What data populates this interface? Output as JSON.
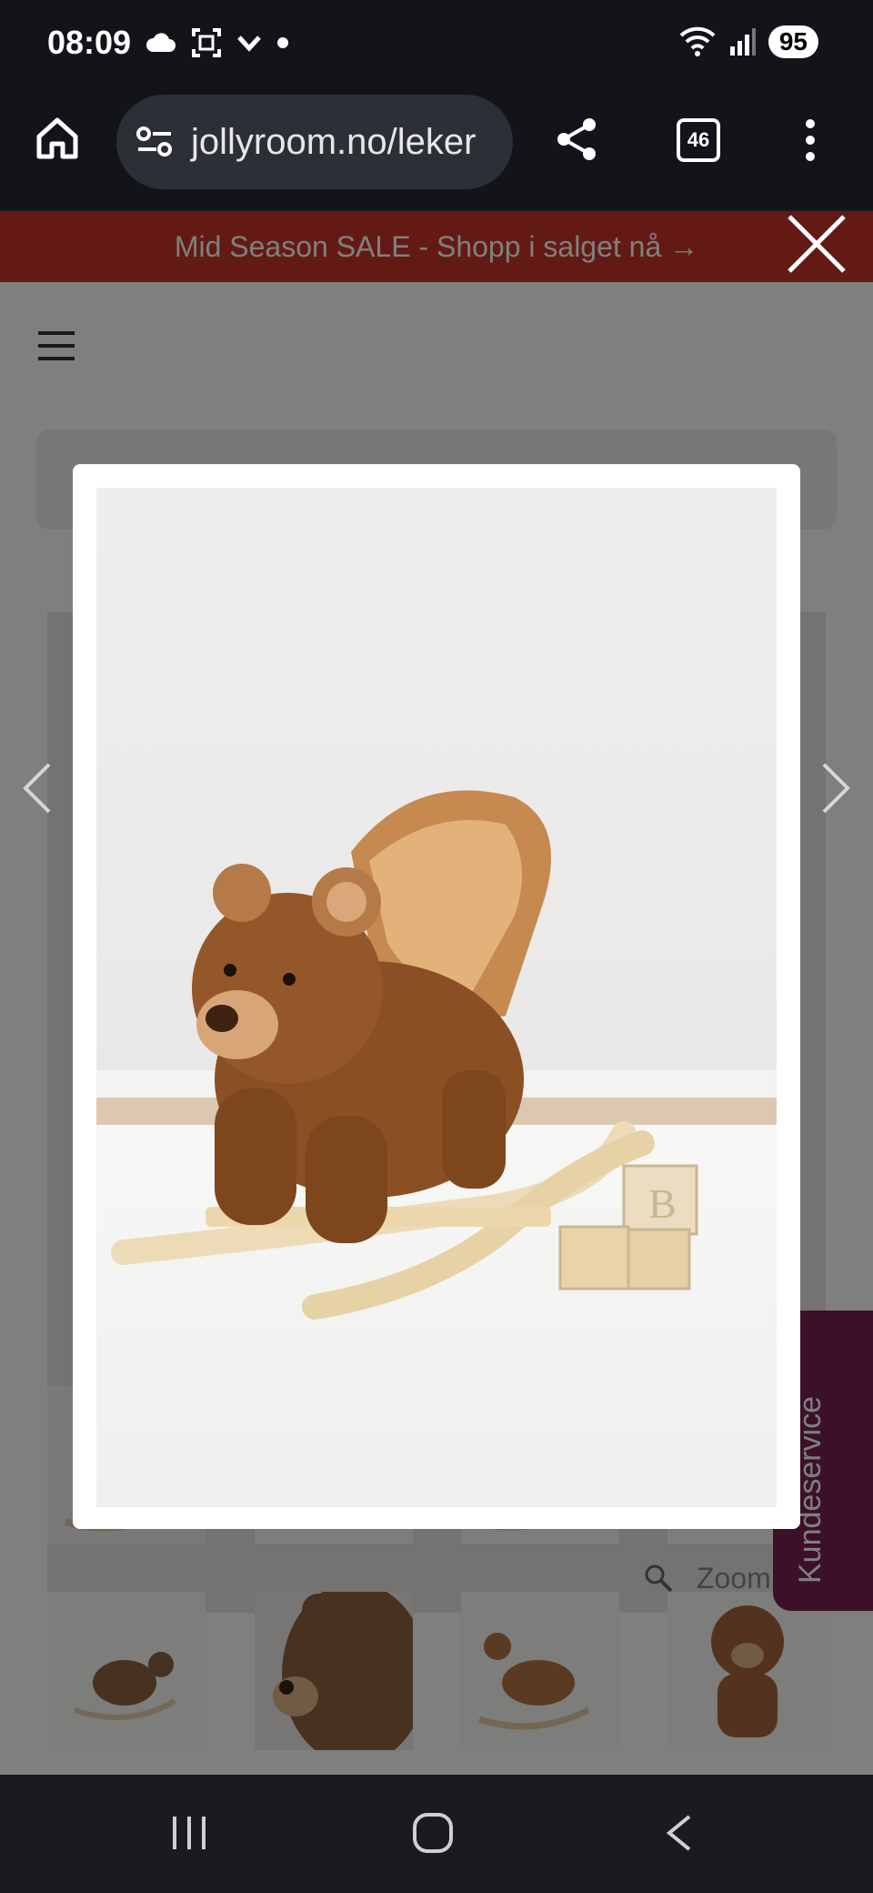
{
  "status": {
    "time": "08:09",
    "battery": "95"
  },
  "browser": {
    "url": "jollyroom.no/leker",
    "tabs": "46"
  },
  "page": {
    "promo": "Mid Season SALE - Shopp i salget nå →",
    "zoom_label": "Zoom",
    "side_tab": "Kundeservice"
  },
  "icons": [
    "home-icon",
    "site-settings-icon",
    "share-icon",
    "tabs-icon",
    "more-icon",
    "close-icon",
    "chevron-left-icon",
    "chevron-right-icon",
    "search-icon",
    "recent-apps-icon",
    "home-button-icon",
    "back-icon"
  ]
}
